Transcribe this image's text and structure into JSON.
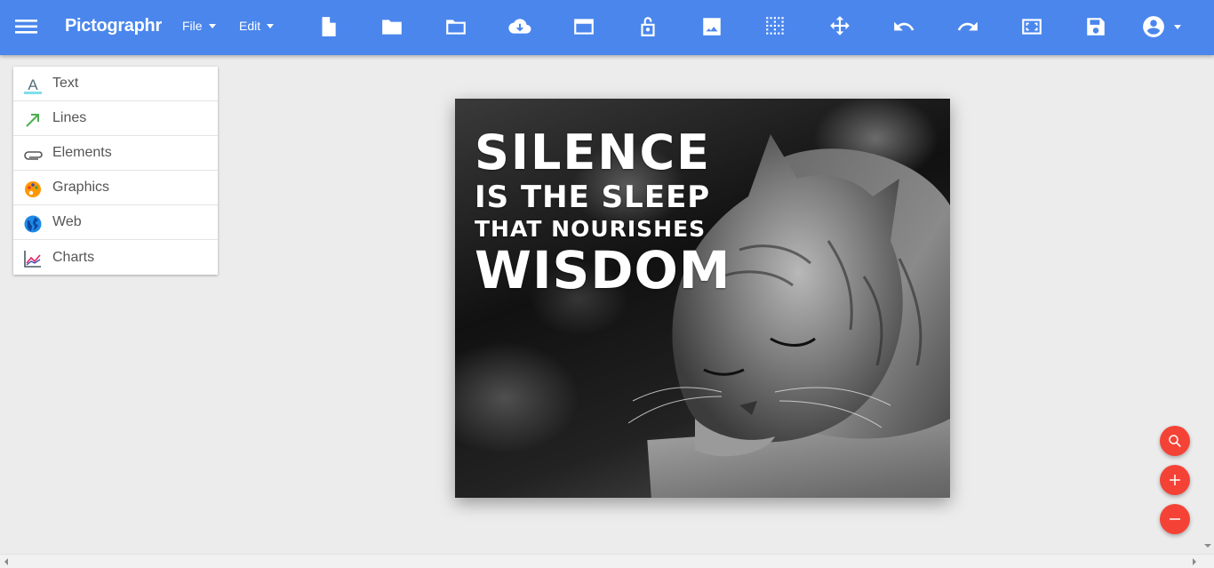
{
  "app": {
    "brand": "Pictographr",
    "menus": [
      "File",
      "Edit"
    ],
    "toolbar_icons": [
      "new-document-icon",
      "open-folder-icon",
      "folder-icon",
      "cloud-download-icon",
      "window-icon",
      "lock-open-icon",
      "image-icon",
      "grid-icon",
      "move-icon",
      "undo-icon",
      "redo-icon",
      "fullscreen-icon",
      "save-icon",
      "account-icon"
    ]
  },
  "sidebar": {
    "items": [
      {
        "label": "Text",
        "icon": "text-icon"
      },
      {
        "label": "Lines",
        "icon": "arrow-line-icon"
      },
      {
        "label": "Elements",
        "icon": "paperclip-icon"
      },
      {
        "label": "Graphics",
        "icon": "palette-icon"
      },
      {
        "label": "Web",
        "icon": "globe-icon"
      },
      {
        "label": "Charts",
        "icon": "chart-icon"
      }
    ]
  },
  "canvas": {
    "quote": {
      "line1": "SILENCE",
      "line2": "IS THE SLEEP",
      "line3": "THAT NOURISHES",
      "line4": "WISDOM"
    }
  },
  "fabs": [
    "zoom-search-icon",
    "zoom-in-icon",
    "zoom-out-icon"
  ],
  "colors": {
    "appbar": "#4a86ec",
    "fab": "#f44336",
    "workspace": "#ececec"
  }
}
